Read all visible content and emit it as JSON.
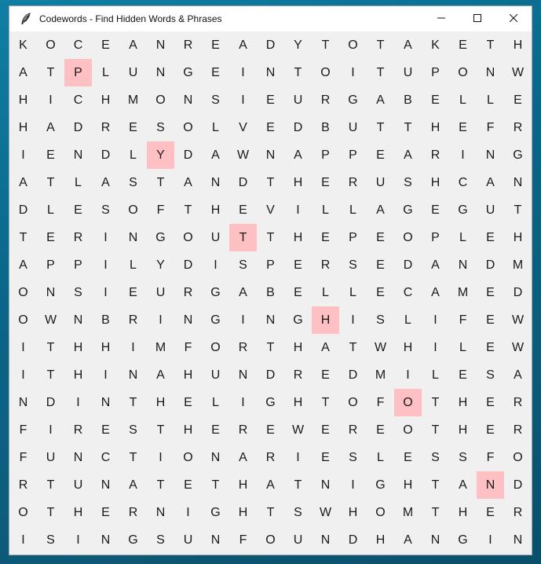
{
  "window": {
    "title": "Codewords - Find Hidden Words & Phrases",
    "app_icon": "feather-icon",
    "controls": [
      "minimize-icon",
      "maximize-icon",
      "close-icon"
    ]
  },
  "grid": {
    "rows": [
      "KOCEANREADYTOTAKETH",
      "ATPLUNGEINTOITUPONW",
      "HICHMONSIEURGABELLE",
      "HADRESOLVEDBUTTHEFR",
      "IENDLYDAWNAPPEARING",
      "ATLASTANDTHERUSHCAN",
      "DLESOFTHEVILLAGEGUT",
      "TERINGOUTTHEPEOPLEH",
      "APPILYDISPERSEDANDM",
      "ONSIEURGABELLECAMED",
      "OWNBRINGINGHISLIFEW",
      "ITHHIMFORTHATWHILEW",
      "ITHINAHUNDREDMILESA",
      "NDINTHELIGHTOFOTHER",
      "FIRESTHEREWEREOTHER",
      "FUNCTIONARIESLESSFO",
      "RTUNATETHATNIGHTAND",
      "OTHERNIGHTSWHOMTHER",
      "ISINGSUNFOUNDHANGIN"
    ],
    "highlighted": [
      {
        "row": 1,
        "col": 2
      },
      {
        "row": 4,
        "col": 5
      },
      {
        "row": 7,
        "col": 8
      },
      {
        "row": 10,
        "col": 11
      },
      {
        "row": 13,
        "col": 14
      },
      {
        "row": 16,
        "col": 17
      }
    ],
    "highlight_color": "#ffc0c4"
  }
}
